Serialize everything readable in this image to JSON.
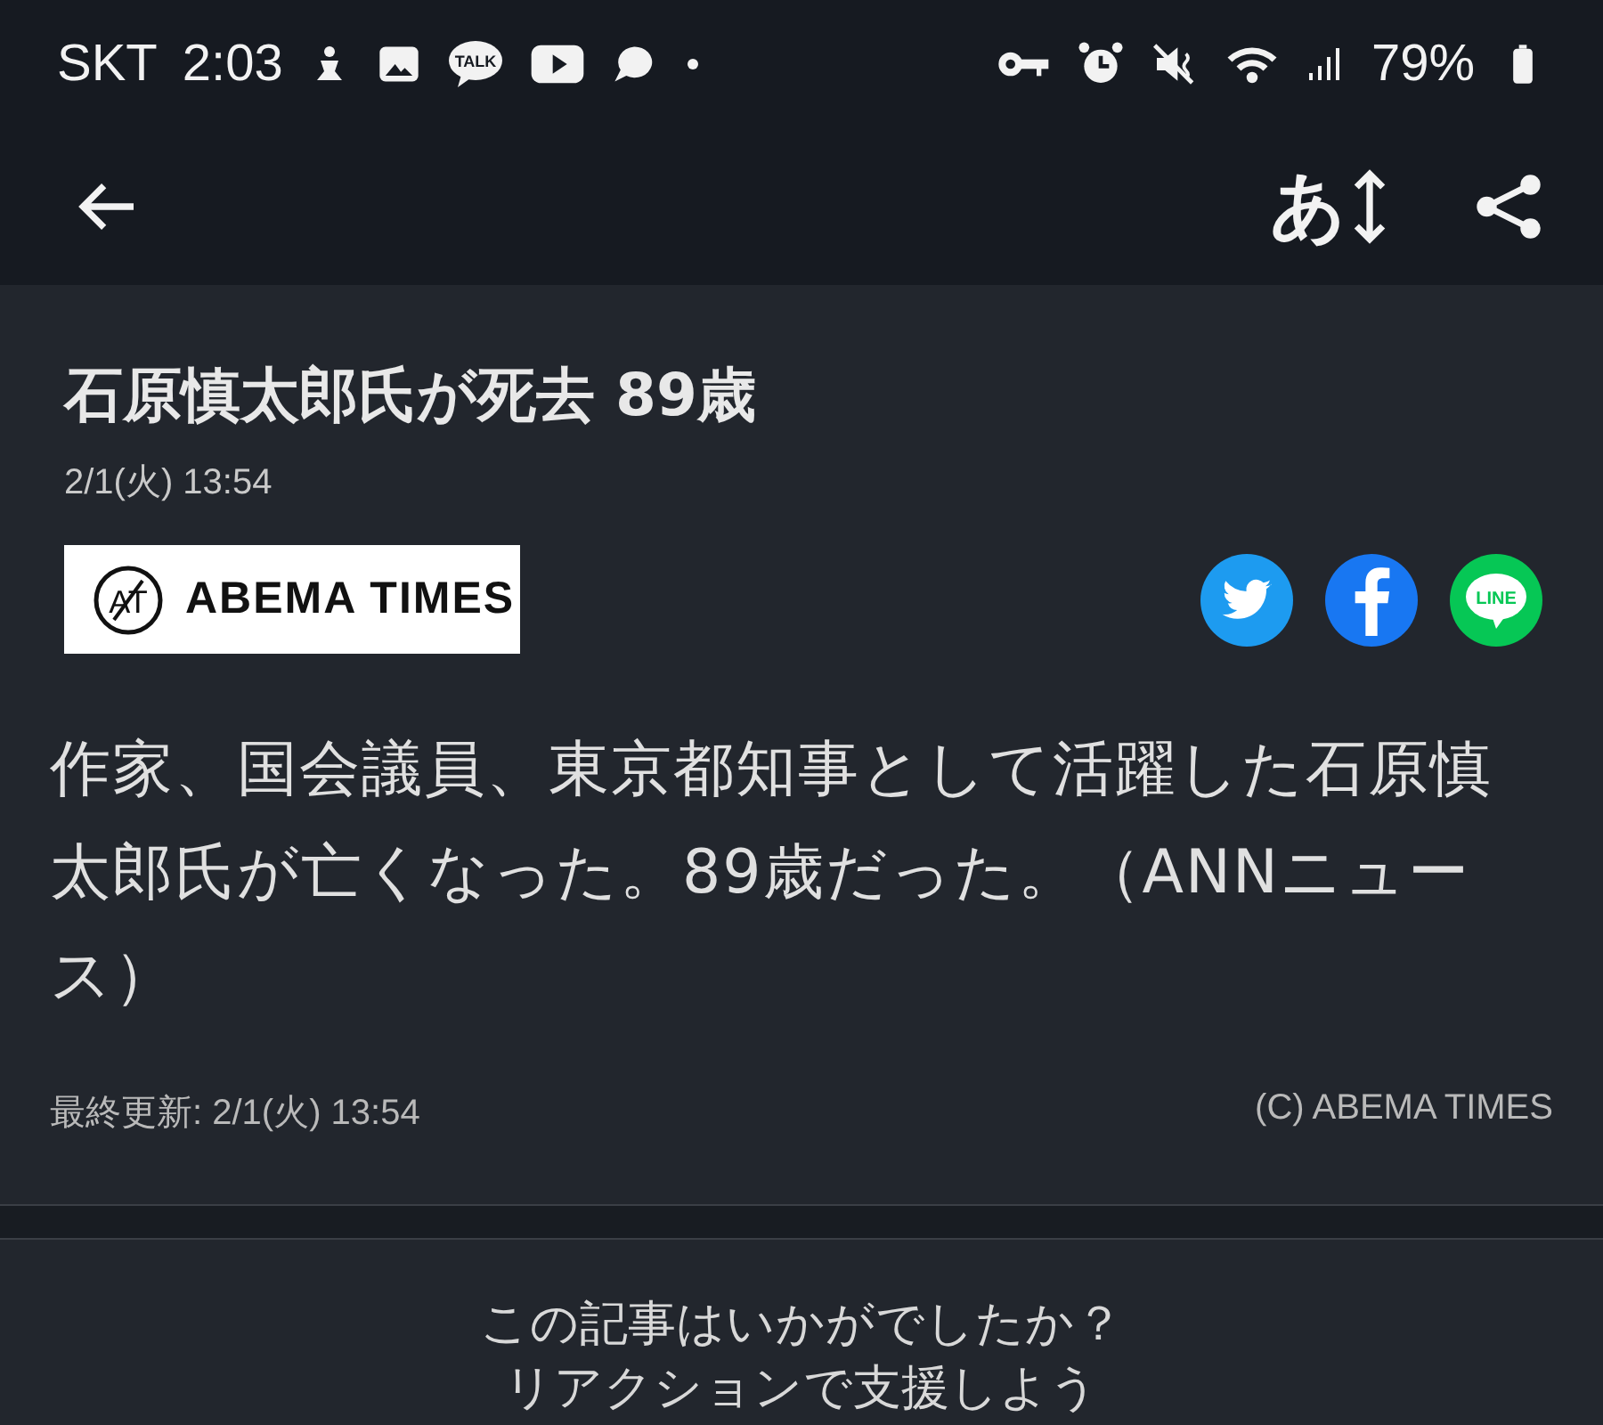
{
  "status_bar": {
    "carrier": "SKT",
    "time": "2:03",
    "talk_badge": "TALK",
    "battery": "79%"
  },
  "app_bar": {
    "text_size_label": "あ"
  },
  "article": {
    "title": "石原慎太郎氏が死去 89歳",
    "date": "2/1(火) 13:54",
    "logo_mark": "AT",
    "logo_text": "ABEMA TIMES",
    "share_line_label": "LINE",
    "body": "作家、国会議員、東京都知事として活躍した石原慎太郎氏が亡くなった。89歳だった。（ANNニュース）",
    "updated": "最終更新: 2/1(火) 13:54",
    "copyright": "(C) ABEMA TIMES"
  },
  "reaction": {
    "question": "この記事はいかがでしたか？",
    "prompt": "リアクションで支援しよう"
  }
}
